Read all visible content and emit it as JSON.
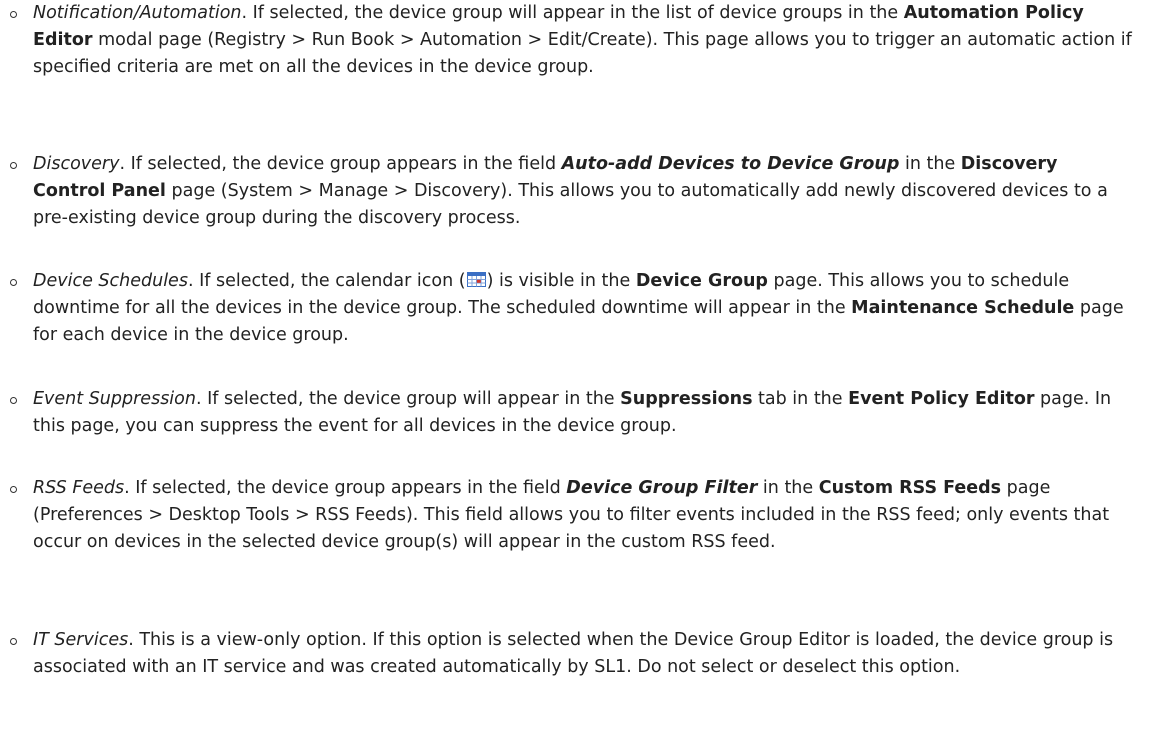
{
  "items": [
    {
      "term": "Notification/Automation",
      "p1": ". If selected, the device group will appear in the list of device groups in the ",
      "b1": "Automation Policy Editor",
      "p2": " modal page (Registry > Run Book > Automation > Edit/Create). This page allows you to trigger an automatic action if specified criteria are met on all the devices in the device group."
    },
    {
      "term": "Discovery",
      "p1": ". If selected, the device group appears in the field ",
      "bi1": "Auto-add Devices to Device Group",
      "p2": " in the ",
      "b1": "Discovery Control Panel",
      "p3": " page (System > Manage > Discovery). This allows you to automatically add newly discovered devices to a pre-existing device group during the discovery process."
    },
    {
      "term": "Device Schedules",
      "p1": ". If selected, the calendar icon (",
      "icon": "calendar-icon",
      "p2": ") is visible in the ",
      "b1": "Device Group",
      "p3": " page. This allows you to schedule downtime for all the devices in the device group. The scheduled downtime will appear in the ",
      "b2": "Maintenance Schedule",
      "p4": " page for each device in the device group."
    },
    {
      "term": "Event Suppression",
      "p1": ". If selected, the device group will appear in the ",
      "b1": "Suppressions",
      "p2": " tab in the ",
      "b2": "Event Policy Editor",
      "p3": " page. In this page, you can suppress the event for all devices in the device group."
    },
    {
      "term": "RSS Feeds",
      "p1": ". If selected, the device group appears in the field ",
      "bi1": "Device Group Filter",
      "p2": " in the ",
      "b1": "Custom RSS Feeds",
      "p3": " page (Preferences > Desktop Tools > RSS Feeds). This field allows you to filter events included in the RSS feed; only events that occur on devices in the selected device group(s) will appear in the custom RSS feed."
    },
    {
      "term": "IT Services",
      "p1": ". This is a view-only option. If this option is selected when the Device Group Editor is loaded, the device group is associated with an IT service and was created automatically by SL1. Do not select or deselect this option."
    }
  ],
  "colors": {
    "text": "#222222",
    "icon_blue": "#3a6fc4",
    "icon_red": "#d0342c"
  }
}
